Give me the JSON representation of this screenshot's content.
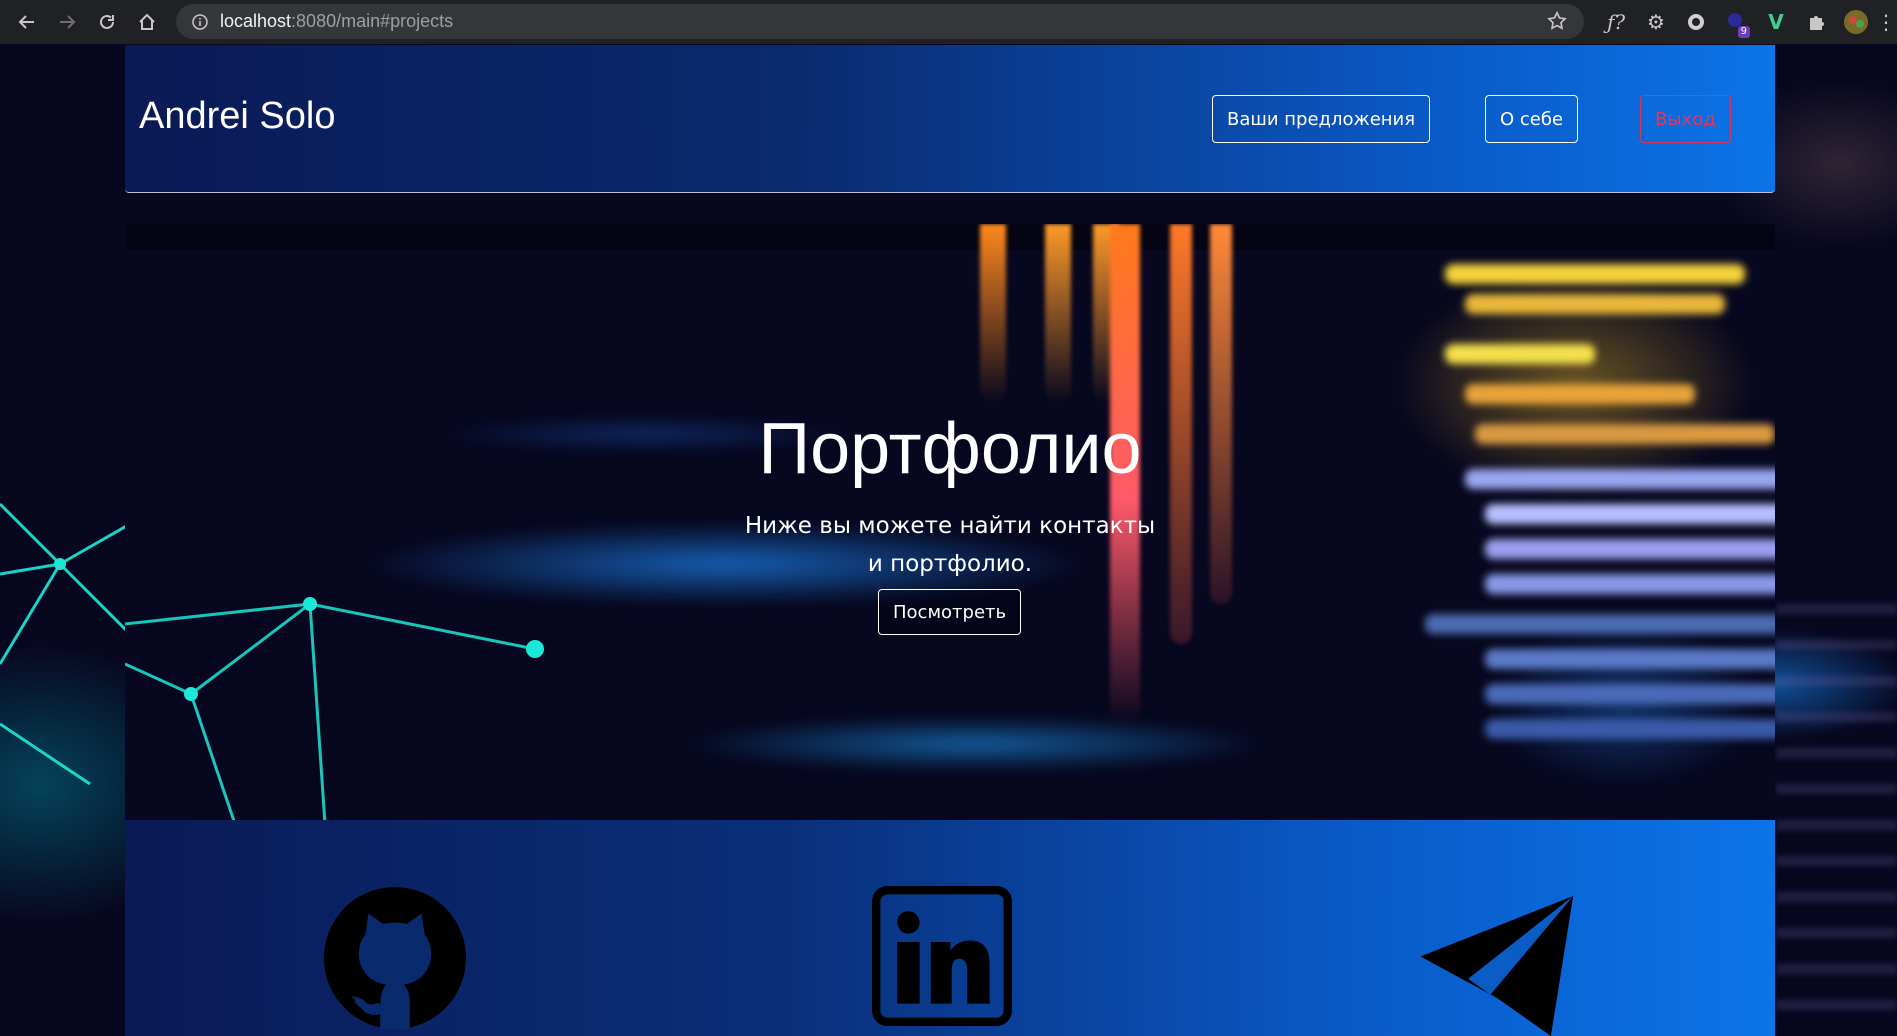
{
  "browser": {
    "url_host": "localhost",
    "url_rest": ":8080/main#projects",
    "extension_badge": "9",
    "extensions": [
      "formula-icon",
      "gear-icon",
      "circle-icon",
      "notification-icon",
      "v-icon",
      "puzzle-icon",
      "avatar"
    ]
  },
  "header": {
    "brand": "Andrei Solo",
    "nav": {
      "offers": "Ваши предложения",
      "about": "О себе",
      "logout": "Выход"
    }
  },
  "hero": {
    "title": "Портфолио",
    "subtitle": "Ниже вы можете найти контакты и портфолио.",
    "button": "Посмотреть"
  },
  "contacts": {
    "icons": [
      "github-icon",
      "linkedin-icon",
      "telegram-icon"
    ]
  },
  "colors": {
    "logout": "#e0375a",
    "header_gradient_start": "#0a1a55",
    "header_gradient_end": "#0b74e8"
  }
}
